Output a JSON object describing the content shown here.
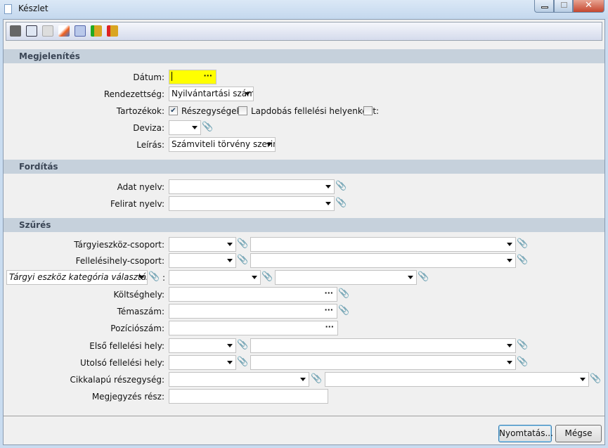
{
  "window": {
    "title": "Készlet"
  },
  "toolbar": {
    "icons": [
      "printer-icon",
      "settings-document-icon",
      "copy-document-icon",
      "edit-icon",
      "calculator-icon",
      "coins-in-icon",
      "coins-out-icon"
    ]
  },
  "sections": {
    "display": "Megjelenítés",
    "translation": "Fordítás",
    "filter": "Szűrés"
  },
  "display": {
    "date_label": "Dátum:",
    "date_value": "",
    "ordering_label": "Rendezettség:",
    "ordering_value": "Nyilvántartási szám",
    "accessories_label": "Tartozékok:",
    "accessories_checked": true,
    "subunits_label": "Részegységek:",
    "subunits_checked": false,
    "pagebreak_label": "Lapdobás fellelési helyenként:",
    "pagebreak_checked": false,
    "currency_label": "Deviza:",
    "currency_value": "",
    "description_label": "Leírás:",
    "description_value": "Számviteli törvény szerint"
  },
  "translation": {
    "data_lang_label": "Adat nyelv:",
    "caption_lang_label": "Felirat nyelv:"
  },
  "filter": {
    "asset_group": "Tárgyieszköz-csoport:",
    "location_group": "Fellelésihely-csoport:",
    "category_select": "Tárgyi eszköz kategória választás",
    "category_colon": ":",
    "cost_center": "Költséghely:",
    "topic_number": "Témaszám:",
    "position_number": "Pozíciószám:",
    "first_location": "Első fellelési hely:",
    "last_location": "Utolsó fellelési hely:",
    "item_subunit": "Cikkalapú részegység:",
    "note_part": "Megjegyzés rész:"
  },
  "buttons": {
    "print": "Nyomtatás...",
    "cancel": "Mégse"
  }
}
